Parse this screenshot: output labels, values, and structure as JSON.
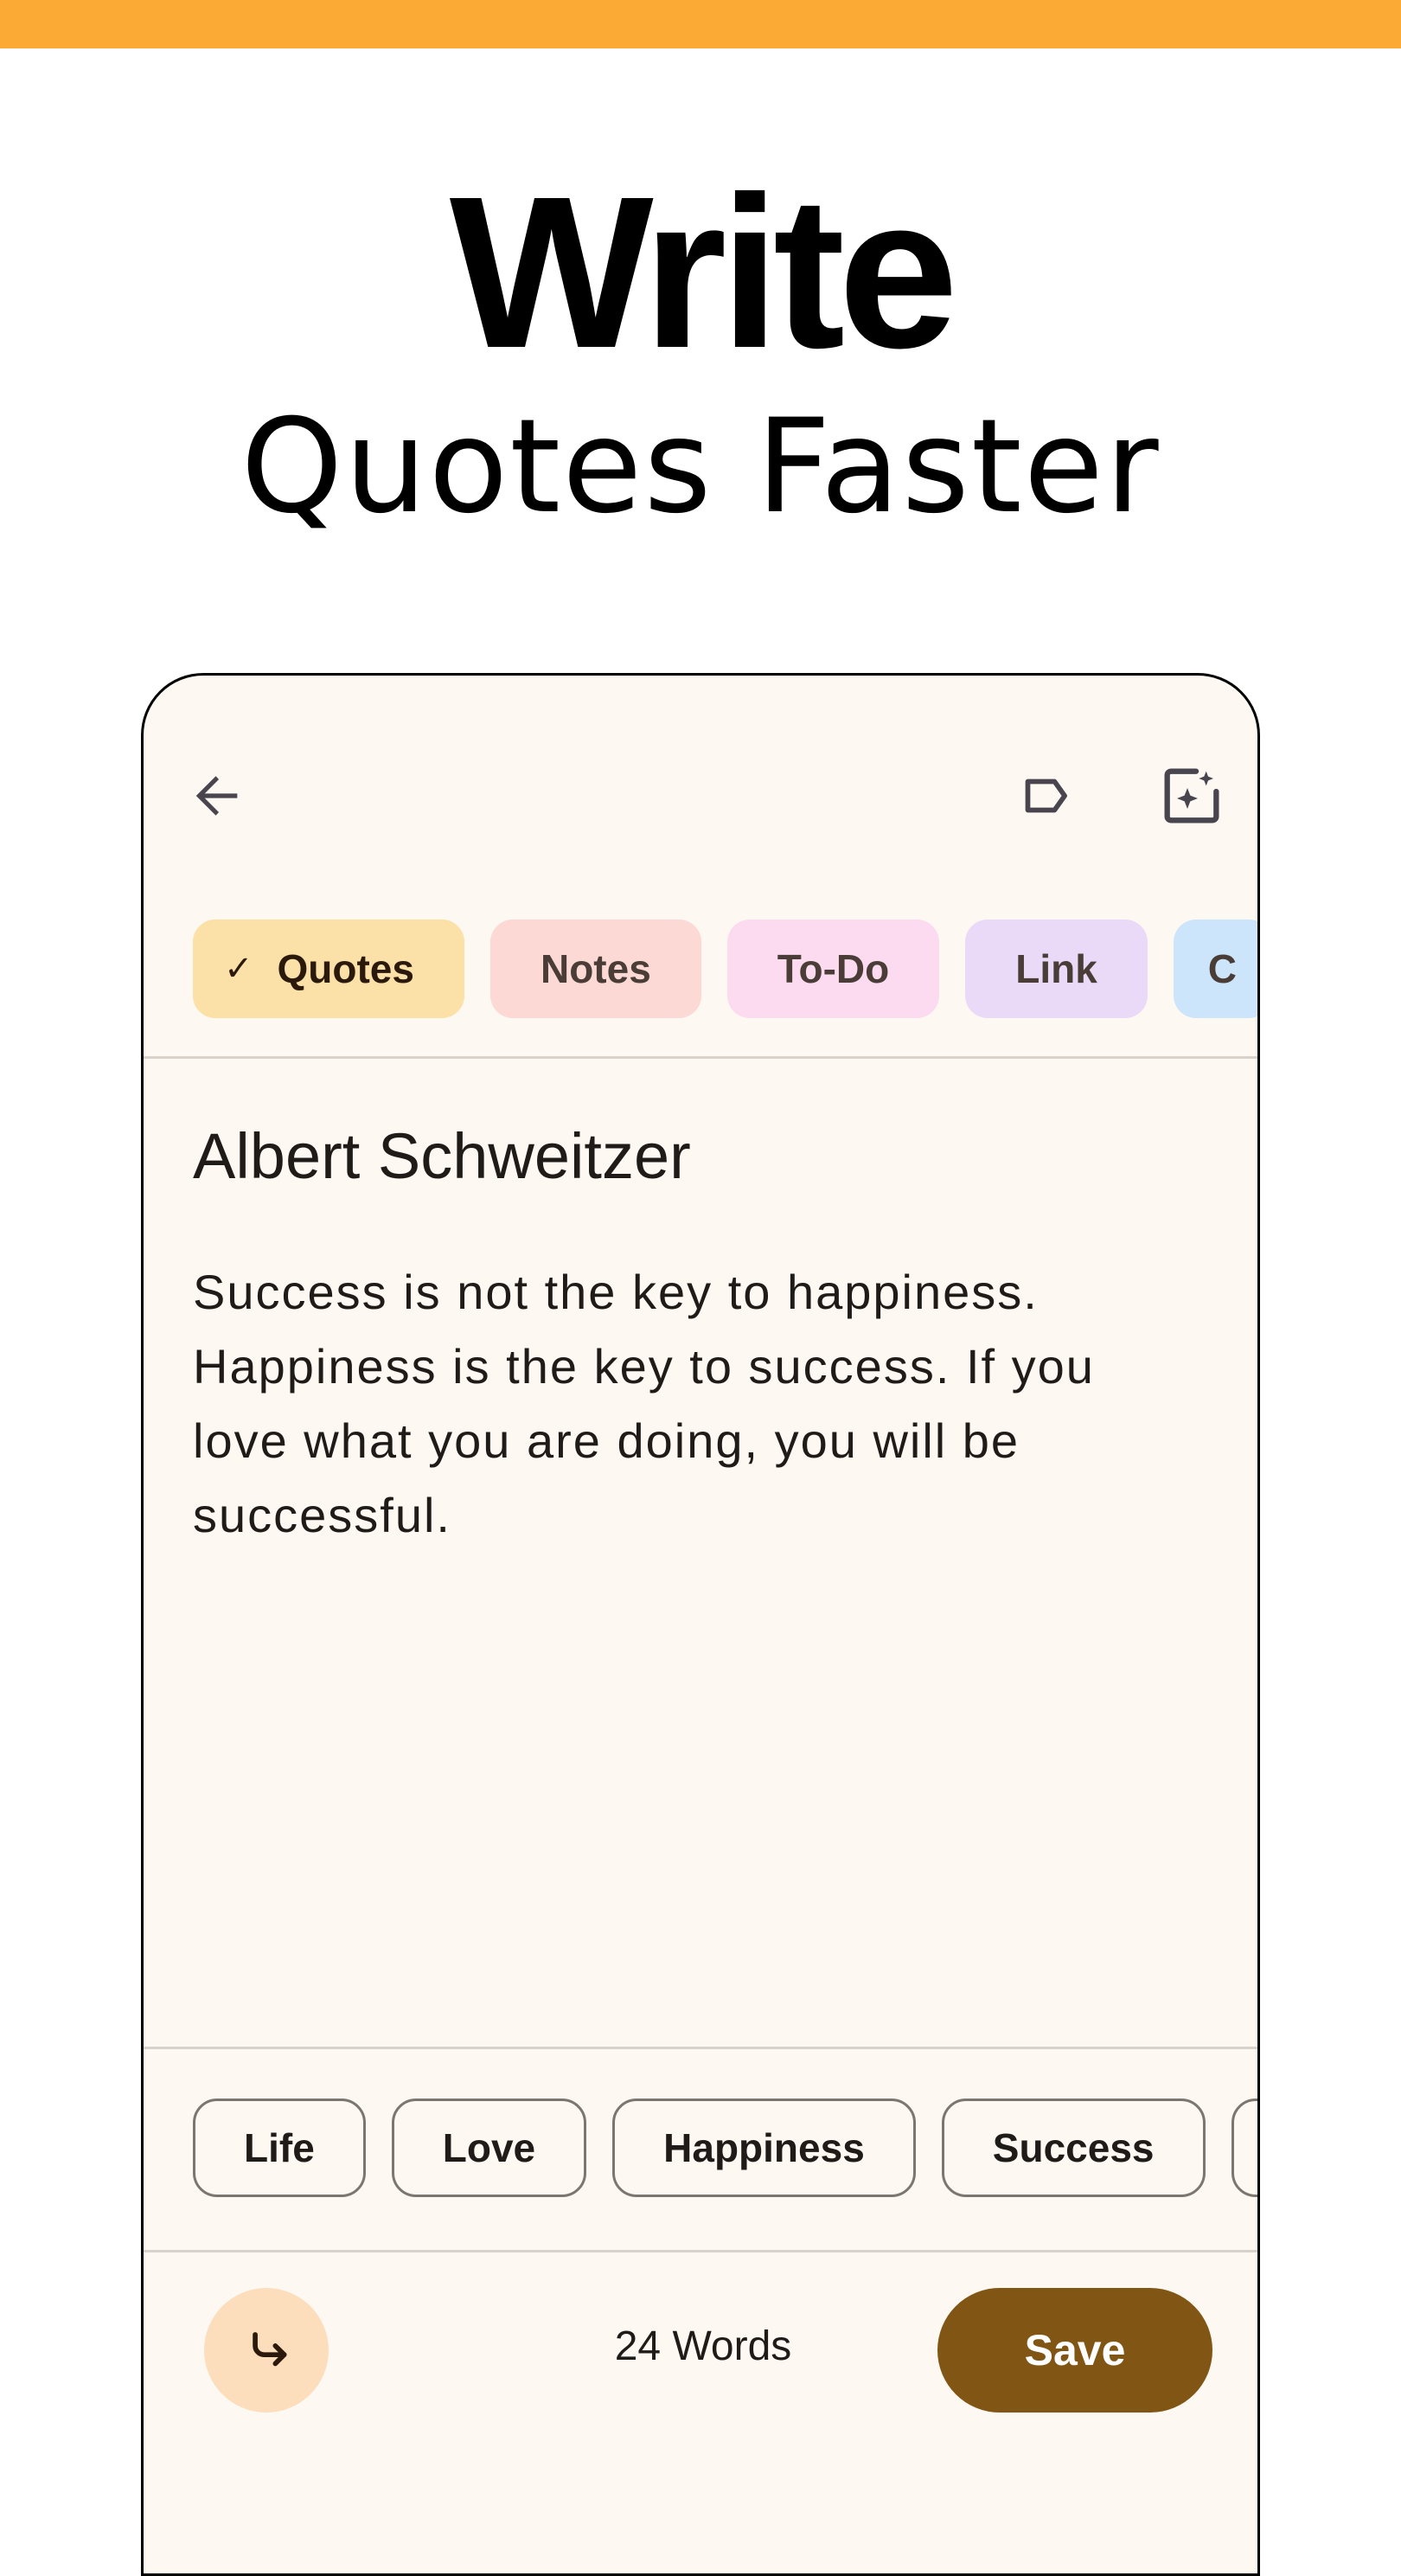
{
  "promo": {
    "headline": "Write",
    "subline": "Quotes Faster",
    "accent_color": "#FBAA36"
  },
  "toolbar": {
    "back_icon": "arrow-back-icon",
    "label_icon": "label-icon",
    "ai_icon": "sparkle-edit-icon"
  },
  "categories": [
    {
      "label": "Quotes",
      "selected": true,
      "color": "#FBE0A8"
    },
    {
      "label": "Notes",
      "selected": false,
      "color": "#FCD9D5"
    },
    {
      "label": "To-Do",
      "selected": false,
      "color": "#FCDAF0"
    },
    {
      "label": "Link",
      "selected": false,
      "color": "#EADAF8"
    },
    {
      "label": "C",
      "selected": false,
      "color": "#CCE5FB"
    }
  ],
  "note": {
    "title": "Albert Schweitzer",
    "body": "Success is not the key to happiness. Happiness is the key to success. If you love what you are doing, you will be successful."
  },
  "tags": [
    {
      "label": "Life"
    },
    {
      "label": "Love"
    },
    {
      "label": "Happiness"
    },
    {
      "label": "Success"
    },
    {
      "label": ""
    }
  ],
  "footer": {
    "redo_icon": "redo-icon",
    "word_count": "24 Words",
    "save_label": "Save",
    "save_color": "#815615"
  }
}
